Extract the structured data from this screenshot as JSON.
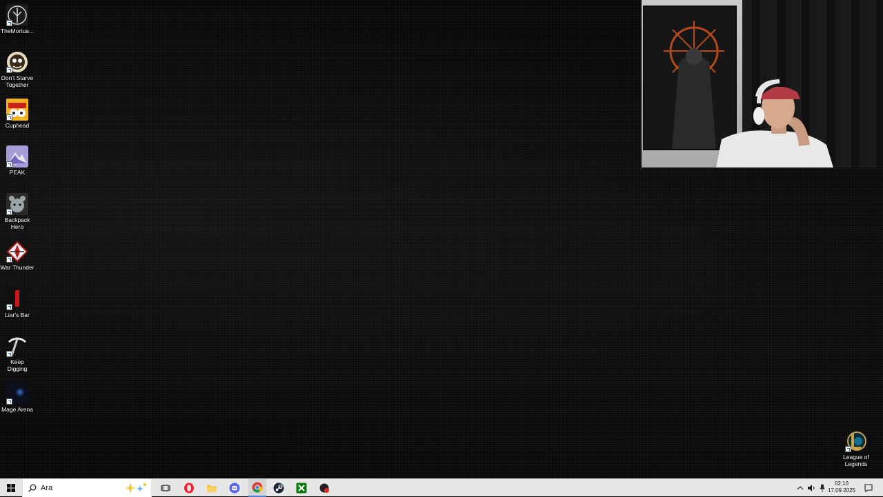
{
  "desktop": {
    "icons": [
      {
        "label": "TheMortua...",
        "icon": "mortuary-assistant-icon"
      },
      {
        "label": "Don't Starve Together",
        "icon": "dont-starve-together-icon"
      },
      {
        "label": "Cuphead",
        "icon": "cuphead-icon"
      },
      {
        "label": "PEAK",
        "icon": "peak-icon"
      },
      {
        "label": "Backpack Hero",
        "icon": "backpack-hero-icon"
      },
      {
        "label": "War Thunder",
        "icon": "war-thunder-icon"
      },
      {
        "label": "Liar's Bar",
        "icon": "liars-bar-icon"
      },
      {
        "label": "Keep Digging",
        "icon": "keep-digging-icon"
      },
      {
        "label": "Mage Arena",
        "icon": "mage-arena-icon"
      }
    ],
    "right_icon": {
      "label": "League of Legends",
      "icon": "league-of-legends-icon"
    }
  },
  "taskbar": {
    "search_placeholder": "Ara",
    "apps": [
      "opera-icon",
      "file-explorer-icon",
      "discord-icon",
      "chrome-icon",
      "steam-icon",
      "xbox-icon",
      "game-app-icon"
    ],
    "clock": {
      "time": "02:10",
      "date": "17.09.2025"
    },
    "colors": {
      "start": "#0a0a0a",
      "opera": "#ff1b2d",
      "discord": "#5865f2",
      "steam": "#1b2838",
      "xbox": "#107c10"
    }
  }
}
